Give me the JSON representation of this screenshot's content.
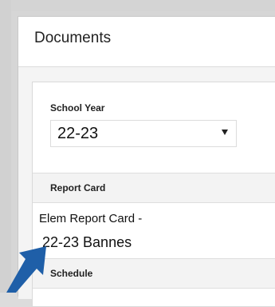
{
  "page": {
    "title": "Documents"
  },
  "school_year": {
    "label": "School Year",
    "selected": "22-23"
  },
  "report_card": {
    "section_label": "Report Card",
    "document": {
      "line1": "Elem Report Card -",
      "line2": "22-23 Bannes"
    }
  },
  "schedule": {
    "section_label": "Schedule"
  },
  "colors": {
    "arrow": "#1f5fa8",
    "background": "#d6d6d6",
    "card": "#ffffff",
    "section_bg": "#f3f3f3"
  },
  "icons": {
    "dropdown": "caret-down-icon",
    "pointer": "arrow-pointer-icon"
  }
}
